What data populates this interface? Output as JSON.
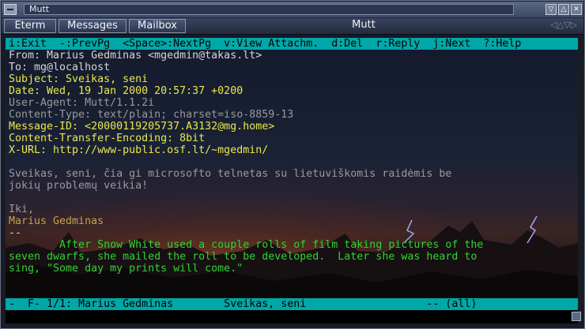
{
  "window": {
    "title": "Mutt",
    "buttons": [
      "▽",
      "△",
      "✕"
    ]
  },
  "tabbar": {
    "tabs": [
      "Eterm",
      "Messages",
      "Mailbox"
    ],
    "terminal_title": "Mutt",
    "arrows": "◁△▽▷"
  },
  "help_bar": "i:Exit  -:PrevPg  <Space>:NextPg  v:View Attachm.  d:Del  r:Reply  j:Next  ?:Help",
  "headers": {
    "from": "From: Marius Gedminas <mgedmin@takas.lt>",
    "to": "To: mg@localhost",
    "subject": "Subject: Sveikas, seni",
    "date": "Date: Wed, 19 Jan 2000 20:57:37 +0200",
    "user_agent": "User-Agent: Mutt/1.1.2i",
    "content_type": "Content-Type: text/plain; charset=iso-8859-13",
    "message_id": "Message-ID: <20000119205737.A3132@mg.home>",
    "encoding": "Content-Transfer-Encoding: 8bit",
    "x_url": "X-URL: http://www-public.osf.lt/~mgedmin/"
  },
  "body": {
    "line1": "Sveikas, seni, čia gi microsofto telnetas su lietuviškomis raidėmis be",
    "line2": "jokių problemų veikia!",
    "line3": "Iki,",
    "line4": "Marius Gedminas",
    "sig_sep": "--",
    "sig1": "        After Snow White used a couple rolls of film taking pictures of the",
    "sig2": "seven dwarfs, she mailed the roll to be developed.  Later she was heard to",
    "sig3": "sing, \"Some day my prints will come.\""
  },
  "status_bar": "-  F- 1/1: Marius Gedminas        Sveikas, seni                   -- (all)",
  "colors": {
    "status_bar_bg": "#00a8a8",
    "header_yellow": "#e8e84c",
    "signature_green": "#33d133"
  }
}
